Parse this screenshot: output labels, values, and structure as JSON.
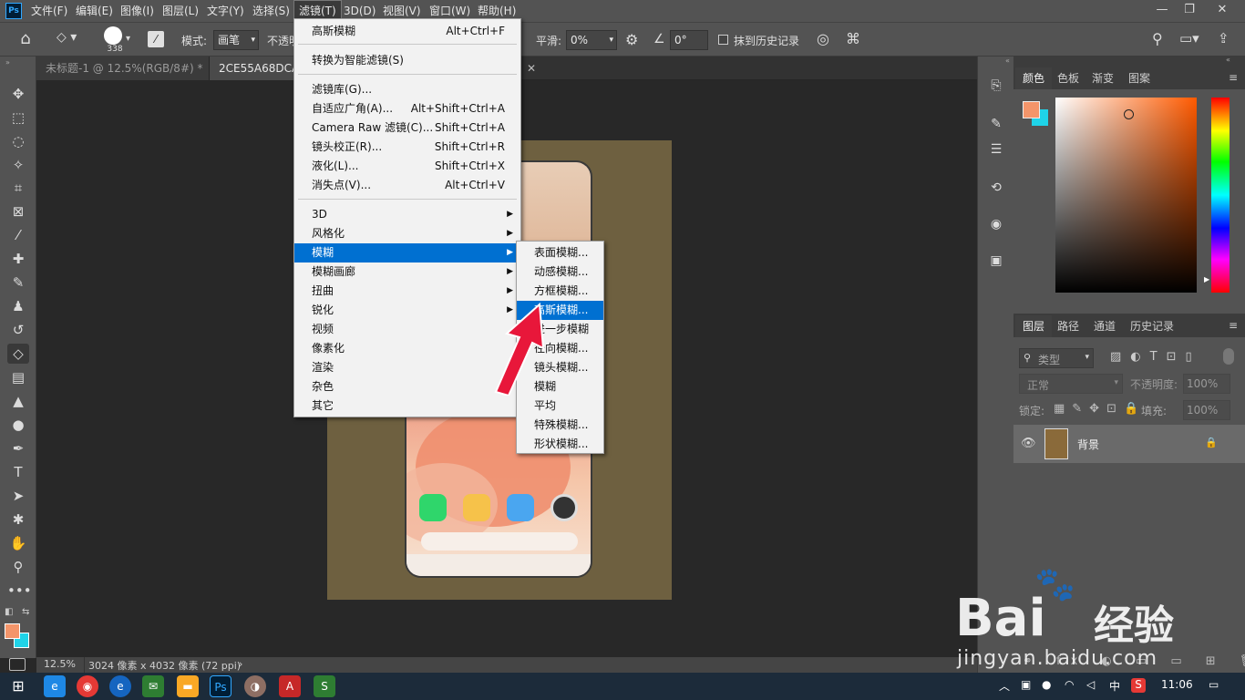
{
  "menubar": {
    "logo": "Ps",
    "items": [
      "文件(F)",
      "编辑(E)",
      "图像(I)",
      "图层(L)",
      "文字(Y)",
      "选择(S)",
      "滤镜(T)",
      "3D(D)",
      "视图(V)",
      "窗口(W)",
      "帮助(H)"
    ],
    "window_controls": [
      "—",
      "❐",
      "✕"
    ]
  },
  "options": {
    "brush_size": "338",
    "mode_label": "模式:",
    "mode_value": "画笔",
    "opacity_label": "不透明",
    "smoothing_label": "平滑:",
    "smoothing_value": "0%",
    "angle_value": "0°",
    "erase_history_label": "抹到历史记录"
  },
  "tabs": [
    {
      "label": "未标题-1 @ 12.5%(RGB/8#) *"
    },
    {
      "label": "2CE55A68DCAE"
    }
  ],
  "filter_menu": {
    "items": [
      {
        "label": "高斯模糊",
        "shortcut": "Alt+Ctrl+F"
      },
      {
        "label": "转换为智能滤镜(S)",
        "shortcut": ""
      },
      {
        "label": "滤镜库(G)...",
        "shortcut": ""
      },
      {
        "label": "自适应广角(A)...",
        "shortcut": "Alt+Shift+Ctrl+A"
      },
      {
        "label": "Camera Raw 滤镜(C)...",
        "shortcut": "Shift+Ctrl+A"
      },
      {
        "label": "镜头校正(R)...",
        "shortcut": "Shift+Ctrl+R"
      },
      {
        "label": "液化(L)...",
        "shortcut": "Shift+Ctrl+X"
      },
      {
        "label": "消失点(V)...",
        "shortcut": "Alt+Ctrl+V"
      },
      {
        "label": "3D",
        "shortcut": ""
      },
      {
        "label": "风格化",
        "shortcut": ""
      },
      {
        "label": "模糊",
        "shortcut": ""
      },
      {
        "label": "模糊画廊",
        "shortcut": ""
      },
      {
        "label": "扭曲",
        "shortcut": ""
      },
      {
        "label": "锐化",
        "shortcut": ""
      },
      {
        "label": "视频",
        "shortcut": ""
      },
      {
        "label": "像素化",
        "shortcut": ""
      },
      {
        "label": "渲染",
        "shortcut": ""
      },
      {
        "label": "杂色",
        "shortcut": ""
      },
      {
        "label": "其它",
        "shortcut": ""
      }
    ]
  },
  "blur_submenu": {
    "items": [
      "表面模糊...",
      "动感模糊...",
      "方框模糊...",
      "高斯模糊...",
      "进一步模糊",
      "径向模糊...",
      "镜头模糊...",
      "模糊",
      "平均",
      "特殊模糊...",
      "形状模糊..."
    ]
  },
  "statusbar": {
    "zoom": "12.5%",
    "doc_info": "3024 像素 x 4032 像素 (72 ppi)"
  },
  "color_panel": {
    "tabs": [
      "颜色",
      "色板",
      "渐变",
      "图案"
    ],
    "foreground": "#f4956a",
    "background": "#1fd3e8"
  },
  "layers_panel": {
    "tabs": [
      "图层",
      "路径",
      "通道",
      "历史记录"
    ],
    "filter_placeholder": "类型",
    "blend_mode": "正常",
    "opacity_label": "不透明度:",
    "opacity_value": "100%",
    "lock_label": "锁定:",
    "fill_label": "填充:",
    "fill_value": "100%",
    "layer_name": "背景"
  },
  "taskbar": {
    "ime": "中",
    "time": "11:06"
  },
  "watermark": {
    "brand": "Bai",
    "brand2": "经验",
    "url": "jingyan.baidu.com"
  }
}
